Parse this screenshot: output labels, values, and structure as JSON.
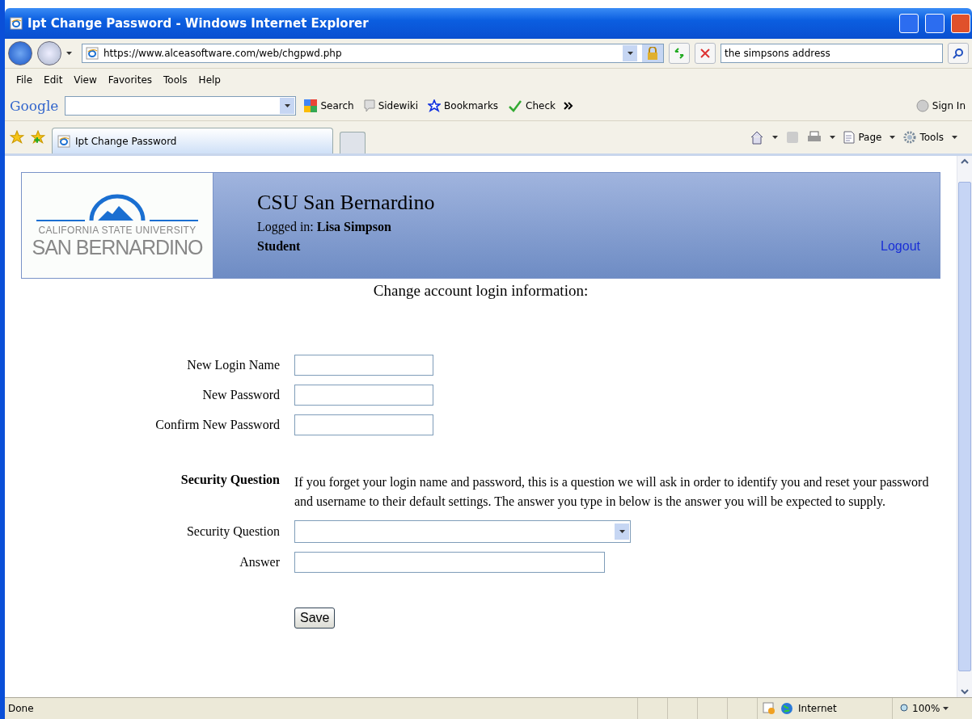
{
  "window": {
    "title": "Ipt Change Password - Windows Internet Explorer"
  },
  "address_bar": {
    "url": "https://www.alceasoftware.com/web/chgpwd.php"
  },
  "search_box": {
    "value": "the simpsons address"
  },
  "menu": [
    "File",
    "Edit",
    "View",
    "Favorites",
    "Tools",
    "Help"
  ],
  "google_toolbar": {
    "logo": "Google",
    "items": [
      {
        "kind": "search",
        "label": "Search"
      },
      {
        "kind": "sidewiki",
        "label": "Sidewiki"
      },
      {
        "kind": "bookmarks",
        "label": "Bookmarks"
      },
      {
        "kind": "check",
        "label": "Check"
      },
      {
        "kind": "signin",
        "label": "Sign In"
      }
    ]
  },
  "tabs": [
    {
      "label": "Ipt Change Password",
      "selected": true
    }
  ],
  "command_bar": [
    {
      "kind": "page",
      "label": "Page"
    },
    {
      "kind": "tools",
      "label": "Tools"
    }
  ],
  "page": {
    "logo": {
      "line_1": "CALIFORNIA STATE UNIVERSITY",
      "line_2": "SAN BERNARDINO"
    },
    "site_title": "CSU San Bernardino",
    "logged_in_label": "Logged in:",
    "user": "Lisa Simpson",
    "role": "Student",
    "logout": "Logout",
    "heading": "Change account login information:",
    "form": [
      {
        "kind": "short-input",
        "label": "New Login Name"
      },
      {
        "kind": "short-input",
        "label": "New Password"
      },
      {
        "kind": "short-input",
        "label": "Confirm New Password"
      },
      {
        "kind": "note",
        "label": "Security Question",
        "text": "If you forget your login name and password, this is a question we will ask in order to identify you and reset your password and username to their default settings. The answer you type in below is the answer you will be expected to supply."
      },
      {
        "kind": "select",
        "label": "Security Question"
      },
      {
        "kind": "long-input",
        "label": "Answer"
      }
    ],
    "save": "Save"
  },
  "status_bar": {
    "text": "Done",
    "zone": "Internet",
    "zoom": "100%"
  }
}
